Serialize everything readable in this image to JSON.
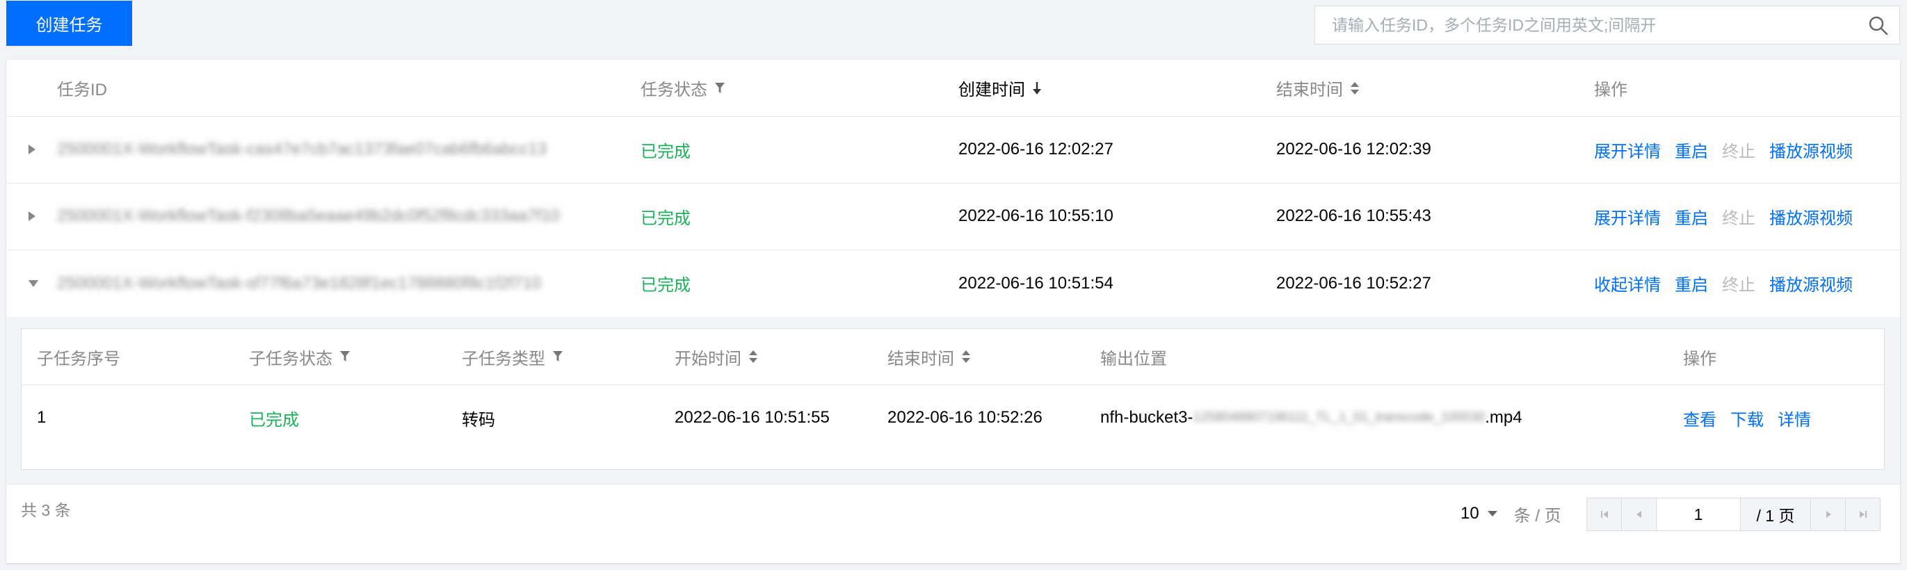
{
  "toolbar": {
    "create_label": "创建任务",
    "search_placeholder": "请输入任务ID，多个任务ID之间用英文;间隔开"
  },
  "table": {
    "headers": {
      "id": "任务ID",
      "status": "任务状态",
      "created": "创建时间",
      "ended": "结束时间",
      "ops": "操作"
    },
    "rows": [
      {
        "id": "2500001X-WorkflowTask-cas47e7cb7ac1373fae07cab6fb6abcc13",
        "status": "已完成",
        "created": "2022-06-16 12:02:27",
        "ended": "2022-06-16 12:02:39",
        "op_detail": "展开详情",
        "op_restart": "重启",
        "op_stop": "终止",
        "op_play": "播放源视频"
      },
      {
        "id": "2500001X-WorkflowTask-f2308ba5eaae49b2dc0f52f8cdc333aa7f10",
        "status": "已完成",
        "created": "2022-06-16 10:55:10",
        "ended": "2022-06-16 10:55:43",
        "op_detail": "展开详情",
        "op_restart": "重启",
        "op_stop": "终止",
        "op_play": "播放源视频"
      },
      {
        "id": "2500001X-WorkflowTask-sf77f6a73e1828f1ec1788880f8c1f2f710",
        "status": "已完成",
        "created": "2022-06-16 10:51:54",
        "ended": "2022-06-16 10:52:27",
        "op_detail": "收起详情",
        "op_restart": "重启",
        "op_stop": "终止",
        "op_play": "播放源视频"
      }
    ]
  },
  "subtable": {
    "headers": {
      "seq": "子任务序号",
      "status": "子任务状态",
      "type": "子任务类型",
      "start": "开始时间",
      "end": "结束时间",
      "output": "输出位置",
      "ops": "操作"
    },
    "rows": [
      {
        "seq": "1",
        "status": "已完成",
        "type": "转码",
        "start": "2022-06-16 10:51:55",
        "end": "2022-06-16 10:52:26",
        "output_prefix": "nfh-bucket3-",
        "output_hidden": "1258048807196111_TL_1_01_transcode_100030",
        "output_suffix": ".mp4",
        "op_view": "查看",
        "op_download": "下载",
        "op_detail": "详情"
      }
    ]
  },
  "footer": {
    "total": "共 3 条",
    "page_size": "10",
    "page_size_unit": "条 / 页",
    "current_page": "1",
    "total_pages": "/ 1 页"
  },
  "colors": {
    "primary": "#006eff",
    "success": "#1bb35a",
    "muted": "#888888",
    "disabled": "#bbbbbb"
  },
  "icons": {
    "search": "search-icon",
    "filter": "filter-icon",
    "sort_desc": "sort-desc-icon",
    "sort": "sort-icon",
    "expand": "caret-right-icon",
    "collapse": "caret-down-icon"
  }
}
